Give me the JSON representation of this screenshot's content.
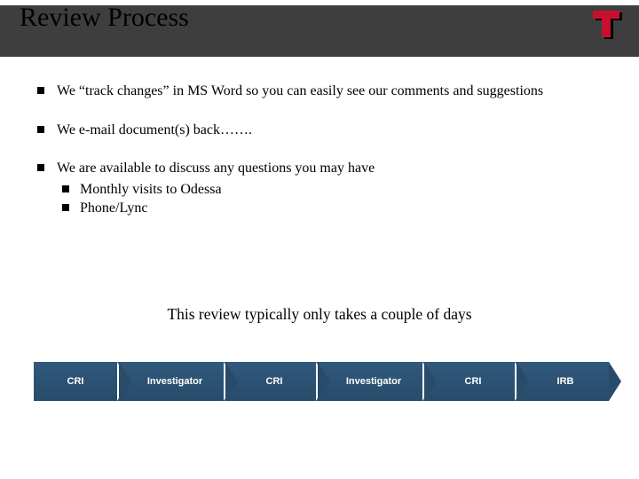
{
  "title": "Review Process",
  "logo": {
    "letter": "T",
    "primary": "#c8102e",
    "shadow": "#000000"
  },
  "bullets": [
    {
      "text": "We “track changes” in MS Word so you can easily see our comments and suggestions"
    },
    {
      "text": "We e-mail document(s) back……."
    },
    {
      "text": "We are available to discuss any questions you may have",
      "sub": [
        {
          "text": "Monthly visits to Odessa"
        },
        {
          "text": "Phone/Lync"
        }
      ]
    }
  ],
  "callout": "This review typically only takes a couple of days",
  "flow_steps": [
    {
      "label": "CRI"
    },
    {
      "label": "Investigator"
    },
    {
      "label": "CRI"
    },
    {
      "label": "Investigator"
    },
    {
      "label": "CRI"
    },
    {
      "label": "IRB"
    }
  ]
}
